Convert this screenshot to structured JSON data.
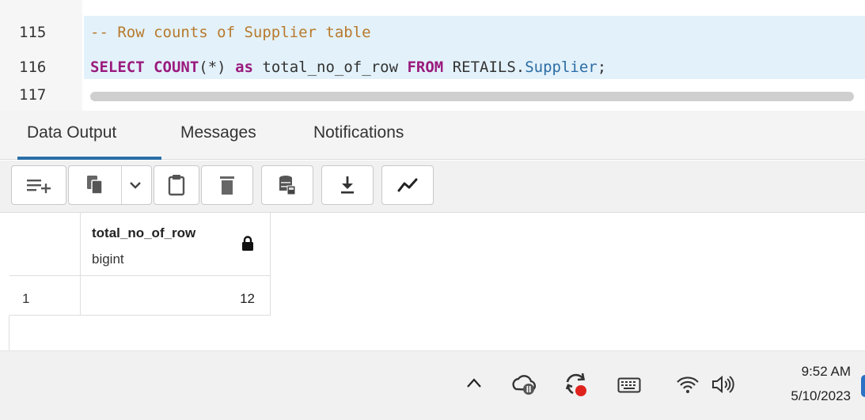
{
  "editor": {
    "lines": [
      {
        "number": "115",
        "comment": "-- Row counts of Supplier table"
      },
      {
        "number": "116",
        "select": "SELECT",
        "count": "COUNT",
        "paren": "(*)",
        "as": "as",
        "alias": "total_no_of_row",
        "from": "FROM",
        "schema": "RETAILS.",
        "table": "Supplier",
        "end": ";"
      },
      {
        "number": "117"
      }
    ]
  },
  "tabs": [
    {
      "label": "Data Output",
      "active": true
    },
    {
      "label": "Messages"
    },
    {
      "label": "Notifications"
    }
  ],
  "toolbar": {
    "buttons": [
      "add-row-icon",
      "copy-icon",
      "chevron-down-icon",
      "paste-icon",
      "delete-icon",
      "save-data-icon",
      "download-icon",
      "graph-visualiser-icon"
    ]
  },
  "grid": {
    "columns": [
      {
        "name": "total_no_of_row",
        "type": "bigint",
        "locked": true
      }
    ],
    "rows": [
      {
        "row_number": "1",
        "values": [
          "12"
        ]
      }
    ]
  },
  "taskbar": {
    "tray_icons": [
      "chevron-up-icon",
      "onedrive-icon",
      "sync-error-icon",
      "keyboard-icon",
      "wifi-icon",
      "volume-icon"
    ],
    "time": "9:52 AM",
    "date": "5/10/2023"
  },
  "colors": {
    "accent": "#2a6fa8",
    "keyword": "#9a1a7d",
    "comment": "#b77a2c",
    "line_highlight": "#e3f1fa"
  }
}
